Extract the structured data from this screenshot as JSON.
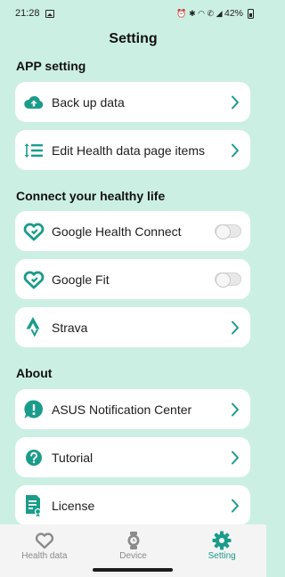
{
  "status_bar": {
    "time": "21:28",
    "battery": "42%"
  },
  "header": {
    "title": "Setting"
  },
  "sections": {
    "app": {
      "title": "APP setting"
    },
    "connect": {
      "title": "Connect your healthy life"
    },
    "about": {
      "title": "About"
    }
  },
  "items": {
    "backup": {
      "label": "Back up data",
      "icon": "cloud-upload-icon"
    },
    "edit_health": {
      "label": "Edit Health data page items",
      "icon": "reorder-icon"
    },
    "google_health_connect": {
      "label": "Google Health Connect",
      "icon": "heart-icon",
      "toggle": false
    },
    "google_fit": {
      "label": "Google Fit",
      "icon": "heart-icon",
      "toggle": false
    },
    "strava": {
      "label": "Strava",
      "icon": "strava-icon"
    },
    "asus_notification": {
      "label": "ASUS Notification Center",
      "icon": "notification-icon"
    },
    "tutorial": {
      "label": "Tutorial",
      "icon": "question-icon"
    },
    "license": {
      "label": "License",
      "icon": "license-icon"
    }
  },
  "bottom_nav": {
    "health": {
      "label": "Health data"
    },
    "device": {
      "label": "Device"
    },
    "setting": {
      "label": "Setting"
    }
  },
  "colors": {
    "accent": "#1a9c8a",
    "background": "#ccefe4",
    "card": "#ffffff"
  }
}
